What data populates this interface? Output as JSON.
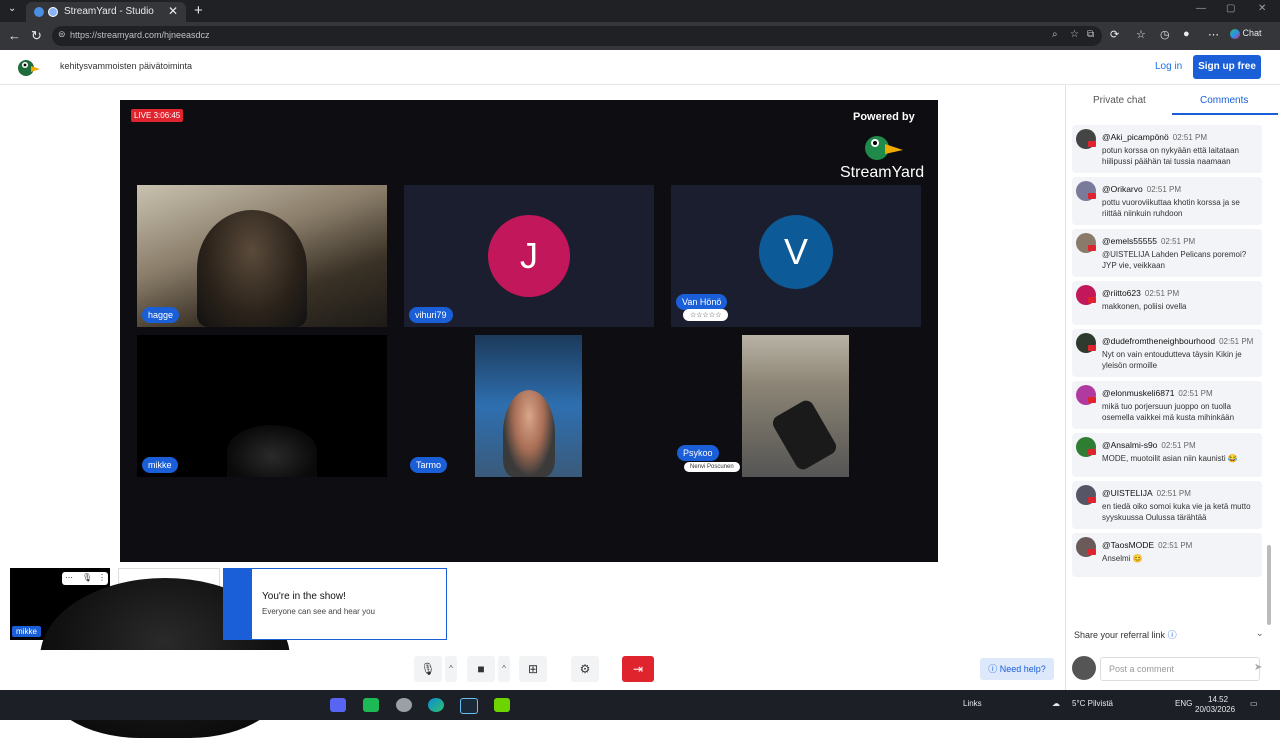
{
  "browser": {
    "tab_title": "StreamYard - Studio",
    "new_tab": "+",
    "tab_close": "✕",
    "url": "https://streamyard.com/hjneeasdcz",
    "chat_label": "Chat",
    "window_controls": [
      "—",
      "▢",
      "✕"
    ]
  },
  "header": {
    "broadcast_title": "kehitysvammoisten päivätoiminta",
    "login": "Log in",
    "signup": "Sign up free"
  },
  "stage": {
    "live_badge": "LIVE 3:06:45",
    "powered_by": "Powered by",
    "brand": "StreamYard",
    "participants": [
      {
        "name": "hagge"
      },
      {
        "name": "vihuri79",
        "initial": "J",
        "color": "#c2185b"
      },
      {
        "name": "Van Hönö",
        "initial": "V",
        "color": "#0d5a99",
        "sub": "☆☆☆☆☆"
      },
      {
        "name": "mikke"
      },
      {
        "name": "Tarmo"
      },
      {
        "name": "Psykoo",
        "sub": "Nenvi Poscunen"
      }
    ]
  },
  "preview": {
    "name": "mikke"
  },
  "toast": {
    "title": "You're in the show!",
    "subtitle": "Everyone can see and hear you"
  },
  "controls": {
    "need_help": "Need help?"
  },
  "panel": {
    "tab_private": "Private chat",
    "tab_comments": "Comments",
    "referral": "Share your referral link",
    "post_placeholder": "Post a comment",
    "comments": [
      {
        "user": "@Aki_picampönö",
        "time": "02:51 PM",
        "text": "potun korssa on nykyään että laitataan hiilipussi päähän tai tussia naamaan",
        "color": "#444"
      },
      {
        "user": "@Orikarvo",
        "time": "02:51 PM",
        "text": "pottu vuoroviikuttaa khotin korssa ja se riittää niinkuin ruhdoon",
        "color": "#7a7a9a"
      },
      {
        "user": "@emels55555",
        "time": "02:51 PM",
        "text": "@UISTELIJA Lahden Pelicans poremoi? JYP vie, veikkaan",
        "color": "#8a7a6a"
      },
      {
        "user": "@riitto623",
        "time": "02:51 PM",
        "text": "makkonen, poliisi ovella",
        "color": "#c2185b"
      },
      {
        "user": "@dudefromtheneighbourhood",
        "time": "02:51 PM",
        "text": "Nyt on vain entoudutteva täysin Kikin je yleisön ormoille",
        "color": "#2e3a2e"
      },
      {
        "user": "@elonmuskeli6871",
        "time": "02:51 PM",
        "text": "mikä tuo porjersuun juoppo on tuolla osemella vaikkei mä kusta mihinkään",
        "color": "#b03aa0"
      },
      {
        "user": "@Ansalmi-s9o",
        "time": "02:51 PM",
        "text": "MODE, muotoilit asian niin kaunisti 😂",
        "color": "#2e7d32"
      },
      {
        "user": "@UISTELIJA",
        "time": "02:51 PM",
        "text": "en tiedä oiko somoi kuka vie ja ketä mutto syyskuussa Oulussa tärähtää",
        "color": "#556"
      },
      {
        "user": "@TaosMODE",
        "time": "02:51 PM",
        "text": "Anselmi 😊",
        "color": "#6a5a5a"
      }
    ]
  },
  "taskbar": {
    "links": "Links",
    "weather": "5°C Pilvistä",
    "lang": "ENG",
    "time": "14.52",
    "date": "20/03/2026"
  }
}
